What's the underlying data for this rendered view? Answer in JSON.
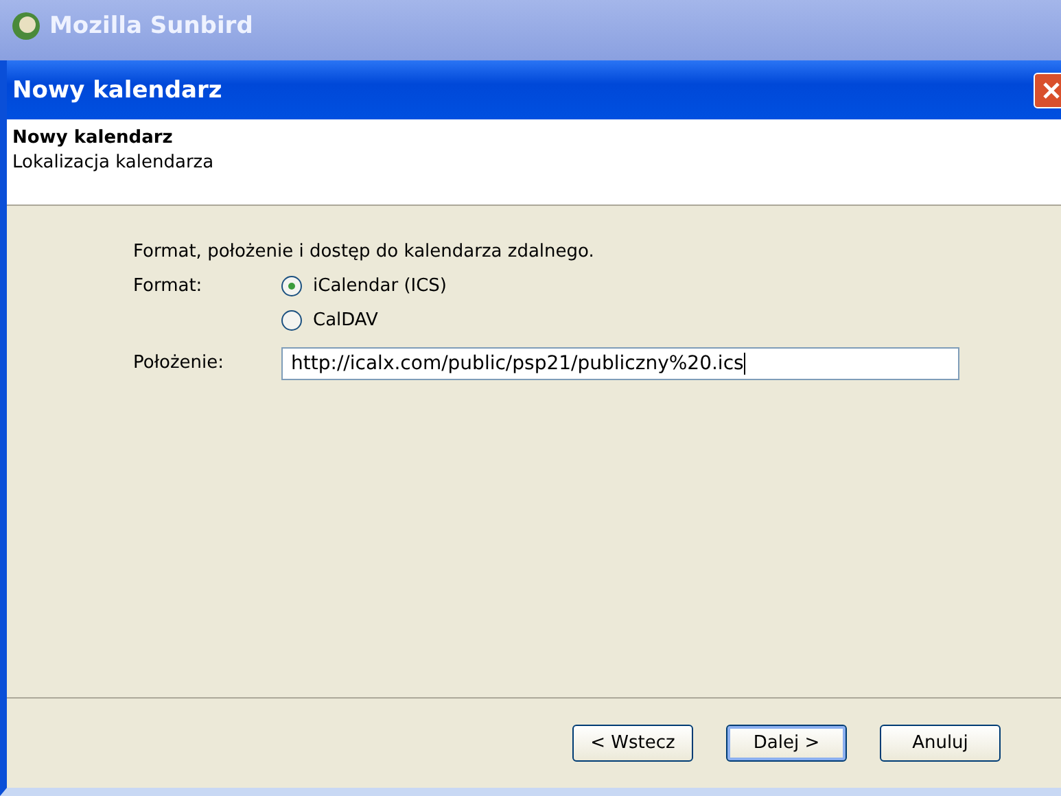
{
  "app_title_bar": {
    "title": "Mozilla Sunbird"
  },
  "dialog": {
    "title": "Nowy kalendarz"
  },
  "header": {
    "title": "Nowy kalendarz",
    "subtitle": "Lokalizacja kalendarza"
  },
  "intro": "Format, położenie i dostęp do kalendarza zdalnego.",
  "format": {
    "label": "Format:",
    "options": [
      {
        "label": "iCalendar (ICS)",
        "selected": true
      },
      {
        "label": "CalDAV",
        "selected": false
      }
    ]
  },
  "location": {
    "label": "Położenie:",
    "value": "http://icalx.com/public/psp21/publiczny%20.ics"
  },
  "buttons": [
    {
      "label": "< Wstecz",
      "default": false
    },
    {
      "label": "Dalej >",
      "default": true
    },
    {
      "label": "Anuluj",
      "default": false
    }
  ]
}
